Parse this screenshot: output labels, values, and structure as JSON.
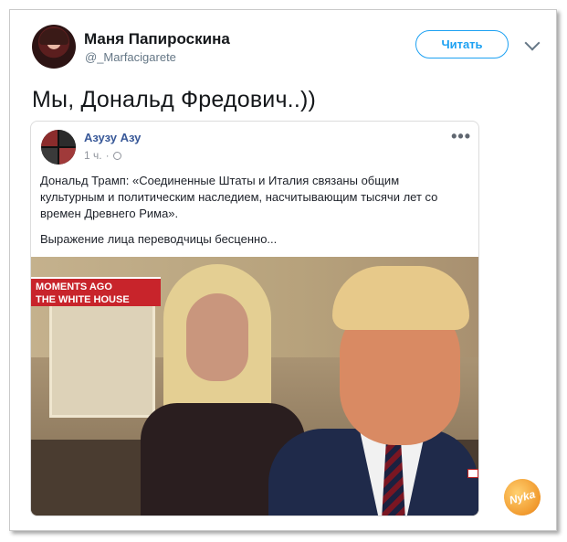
{
  "tweet": {
    "author": {
      "name": "Маня Папироскина",
      "handle": "@_Marfacigarete",
      "avatar_icon": "profile-avatar"
    },
    "follow_label": "Читать",
    "text": "Мы, Дональд Фредович..))"
  },
  "embedded_post": {
    "author_name": "Азузу Азу",
    "time": "1 ч.",
    "separator": "·",
    "more_icon": "•••",
    "body_text": "Дональд Трамп: «Соединенные Штаты и Италия связаны общим культурным и политическим наследием, насчитывающим тысячи лет со времен Древнего Рима».",
    "caption": "Выражение лица переводчицы бесценно...",
    "photo": {
      "lower_third_line1": "MOMENTS AGO",
      "lower_third_line2": "THE WHITE HOUSE"
    }
  },
  "watermark": {
    "text": "Nyka"
  },
  "colors": {
    "accent": "#1da1f2",
    "fb_name": "#385898",
    "news_red": "#c8242b"
  }
}
